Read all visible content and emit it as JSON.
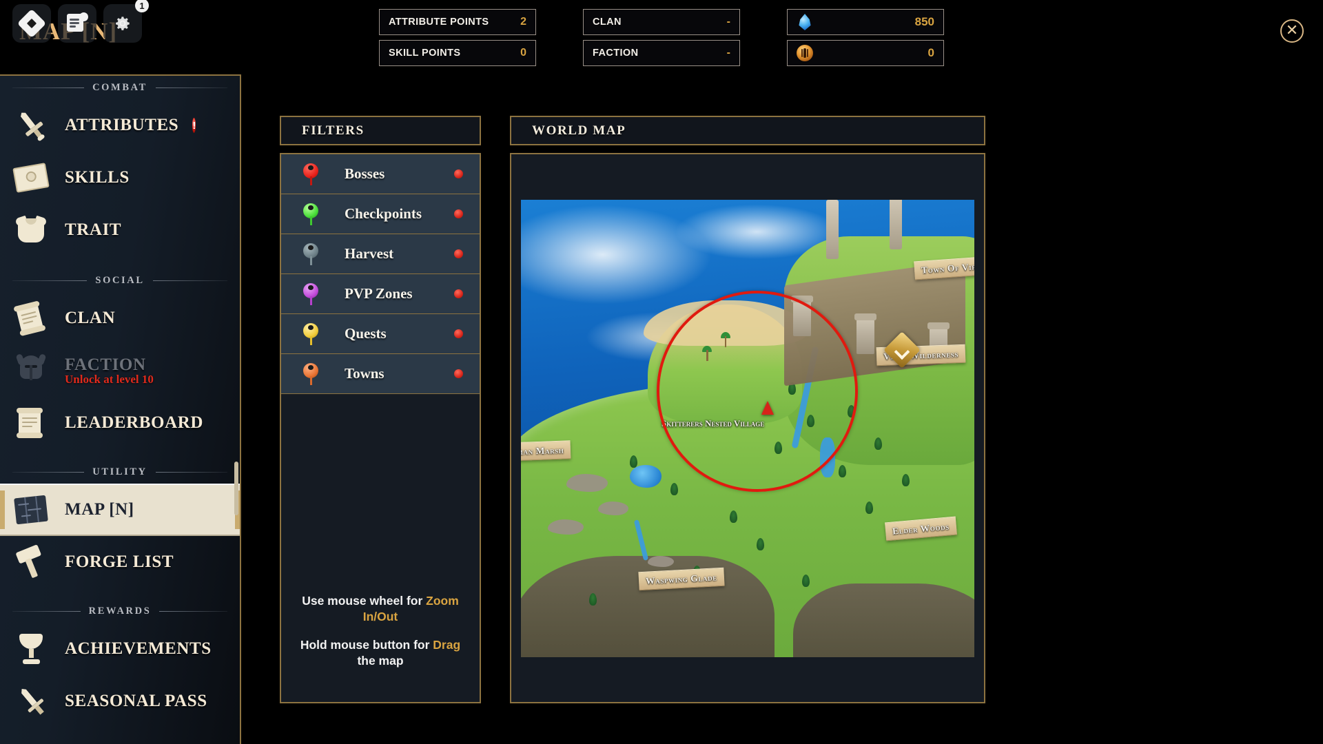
{
  "topbar": {
    "roblox_icon": "roblox-logo-icon",
    "chat_icon": "chat-icon",
    "settings_icon": "gear-icon",
    "settings_badge": "1"
  },
  "page_title": "MAP [N]",
  "close_label": "✕",
  "stats": [
    {
      "key": "ATTRIBUTE POINTS",
      "value": "2"
    },
    {
      "key": "SKILL POINTS",
      "value": "0"
    },
    {
      "key": "CLAN",
      "value": "-"
    },
    {
      "key": "FACTION",
      "value": "-"
    }
  ],
  "currencies": [
    {
      "icon": "shard-icon",
      "value": "850"
    },
    {
      "icon": "coin-icon",
      "value": "0"
    }
  ],
  "sidebar": {
    "sections": [
      {
        "title": "COMBAT",
        "items": [
          {
            "label": "ATTRIBUTES",
            "icon": "sword-icon",
            "alert": "!",
            "selected": false,
            "disabled": false
          },
          {
            "label": "SKILLS",
            "icon": "book-icon",
            "selected": false,
            "disabled": false
          },
          {
            "label": "TRAIT",
            "icon": "armor-icon",
            "selected": false,
            "disabled": false
          }
        ]
      },
      {
        "title": "SOCIAL",
        "items": [
          {
            "label": "CLAN",
            "icon": "scroll-icon",
            "selected": false,
            "disabled": false
          },
          {
            "label": "FACTION",
            "icon": "helm-icon",
            "sub": "Unlock at level 10",
            "selected": false,
            "disabled": true
          },
          {
            "label": "LEADERBOARD",
            "icon": "scroll-icon",
            "selected": false,
            "disabled": false
          }
        ]
      },
      {
        "title": "UTILITY",
        "items": [
          {
            "label": "MAP [N]",
            "icon": "map-icon",
            "selected": true,
            "disabled": false
          },
          {
            "label": "FORGE LIST",
            "icon": "hammer-icon",
            "selected": false,
            "disabled": false
          }
        ]
      },
      {
        "title": "REWARDS",
        "items": [
          {
            "label": "ACHIEVEMENTS",
            "icon": "chalice-icon",
            "selected": false,
            "disabled": false
          },
          {
            "label": "SEASONAL PASS",
            "icon": "dagger-icon",
            "selected": false,
            "disabled": false
          }
        ]
      }
    ]
  },
  "filters": {
    "title": "FILTERS",
    "items": [
      {
        "label": "Bosses",
        "pin_color": "#e8211a",
        "enabled": true
      },
      {
        "label": "Checkpoints",
        "pin_color": "#4ade3a",
        "enabled": true
      },
      {
        "label": "Harvest",
        "pin_color": "#6d8088",
        "enabled": true
      },
      {
        "label": "PVP Zones",
        "pin_color": "#c34ddb",
        "enabled": true
      },
      {
        "label": "Quests",
        "pin_color": "#f2cc3c",
        "enabled": true
      },
      {
        "label": "Towns",
        "pin_color": "#e87434",
        "enabled": true
      }
    ],
    "hints": [
      {
        "pre": "Use mouse wheel for ",
        "highlight": "Zoom In/Out",
        "post": ""
      },
      {
        "pre": "Hold mouse button for ",
        "highlight": "Drag",
        "post": " the map"
      }
    ]
  },
  "world_map": {
    "title": "WORLD MAP",
    "regions": [
      {
        "name": "Town Of Vir",
        "style": "banner"
      },
      {
        "name": "Viros Wilderness",
        "style": "banner"
      },
      {
        "name": "Elder Woods",
        "style": "banner"
      },
      {
        "name": "Waspwing Glade",
        "style": "banner"
      },
      {
        "name": "Dman Marsh",
        "style": "banner"
      },
      {
        "name": "Skitterers Nested Village",
        "style": "free"
      }
    ],
    "markers": {
      "player_position": "player-arrow-marker",
      "quest_marker": "quest-diamond-marker",
      "highlight_circle_color": "#e01a0f"
    }
  },
  "colors": {
    "accent_gold": "#d9a441",
    "border_gold": "#8d7340",
    "panel_bg": "#151b23",
    "row_bg": "#2b3947",
    "alert_red": "#d8251a",
    "selected_bg": "#e8e1cf"
  }
}
